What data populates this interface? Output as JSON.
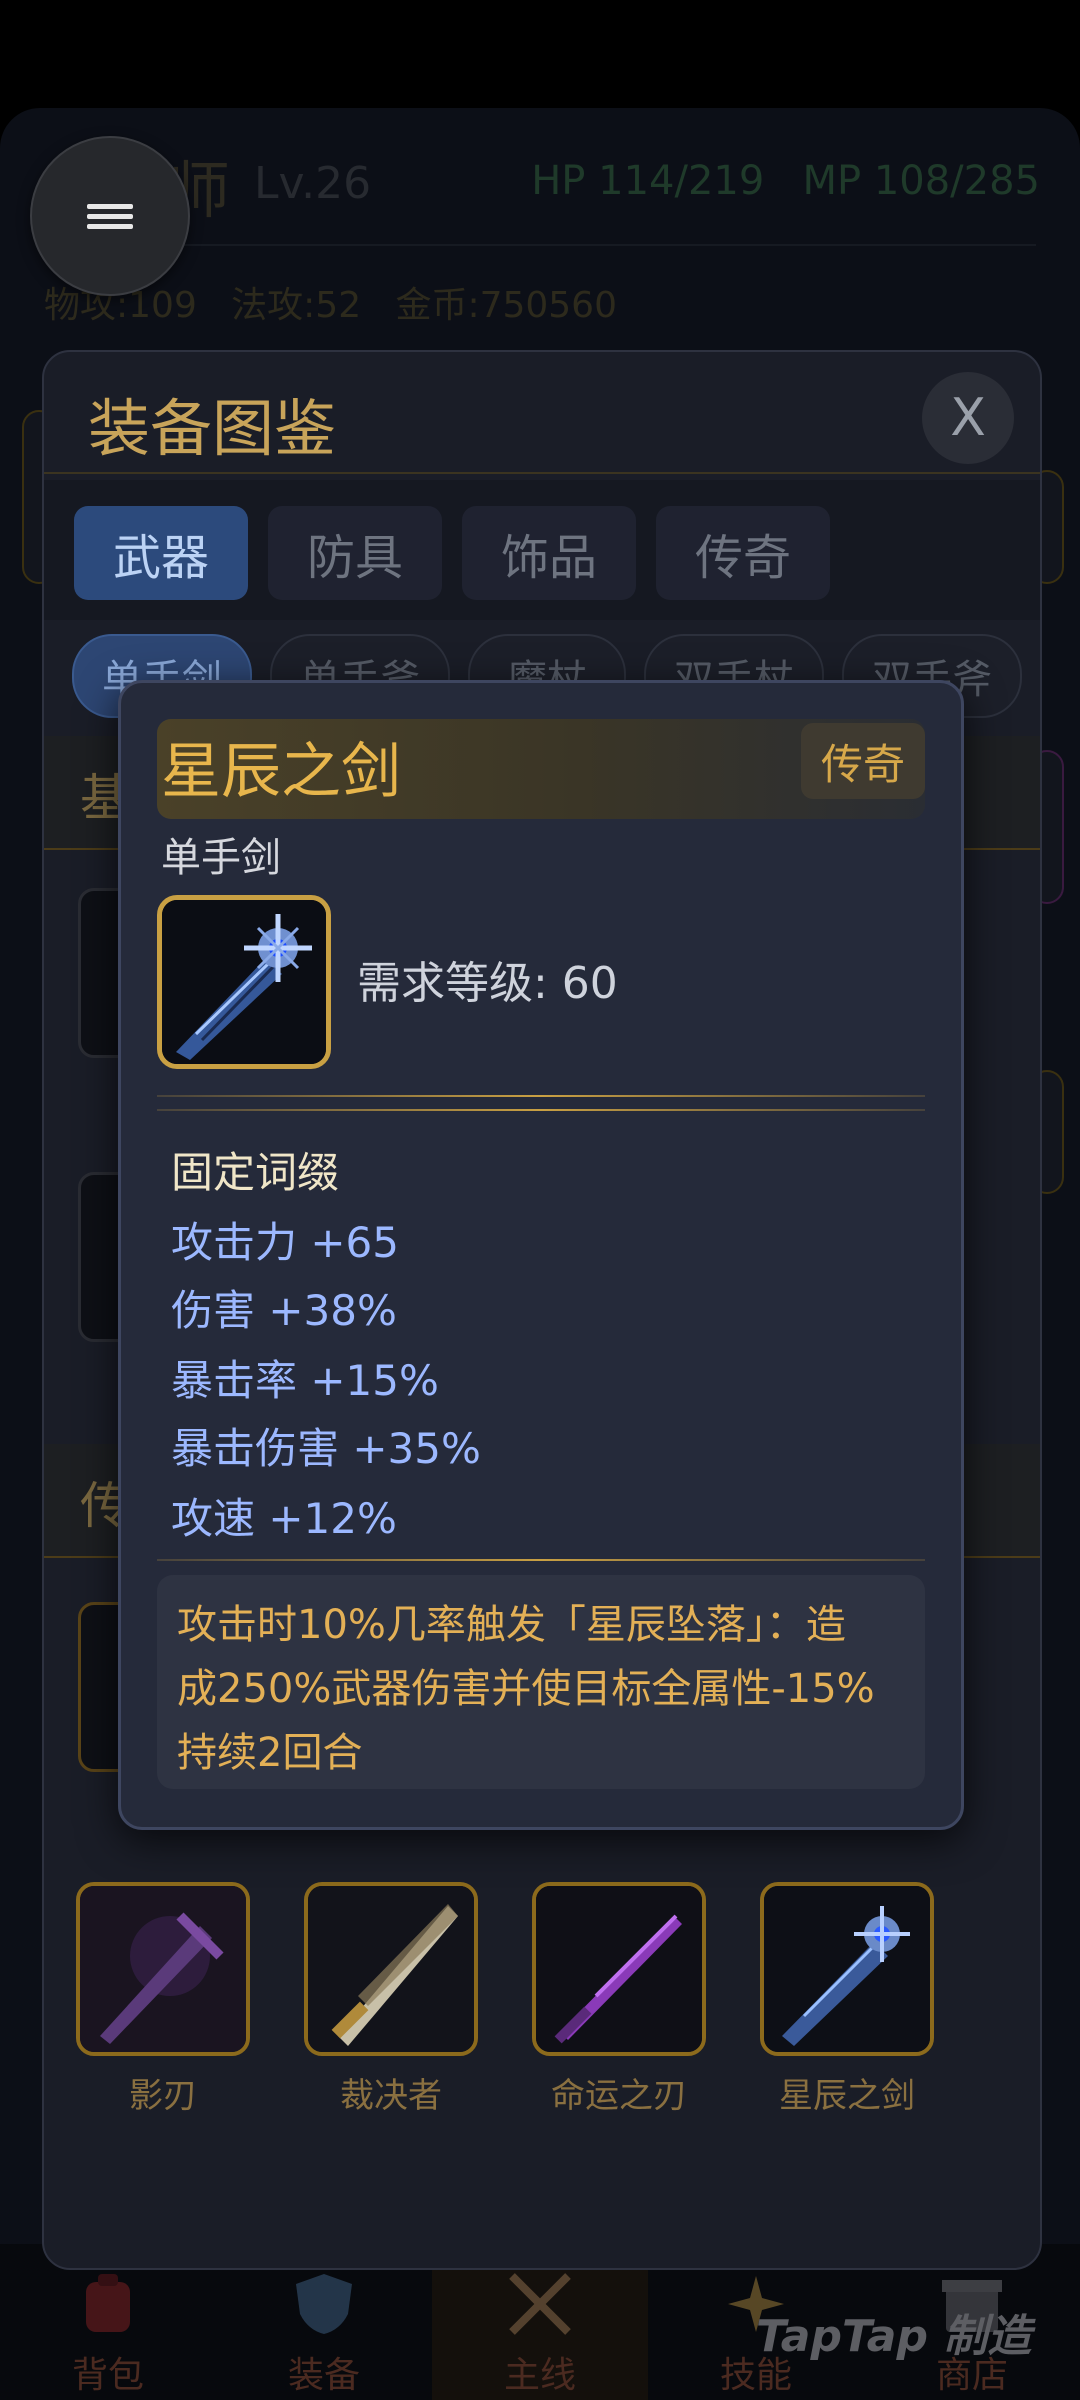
{
  "background": {
    "character": "魔法师",
    "level": "Lv.26",
    "hp": "HP 114/219",
    "mp": "MP 108/285",
    "stats": "物攻:109   法攻:52   金币:750560"
  },
  "panel": {
    "title": "装备图鉴",
    "close_label": "X",
    "tabs": [
      "武器",
      "防具",
      "饰品",
      "传奇"
    ],
    "chips": [
      "单手剑",
      "单手斧",
      "魔杖",
      "双手杖",
      "双手斧"
    ],
    "section_titles": [
      "基",
      "传"
    ],
    "items": [
      {
        "name": "影刃",
        "icon": "shadow-blade-icon"
      },
      {
        "name": "裁决者",
        "icon": "judgement-sword-icon"
      },
      {
        "name": "命运之刃",
        "icon": "fate-blade-icon"
      },
      {
        "name": "星辰之剑",
        "icon": "star-sword-icon"
      }
    ]
  },
  "tooltip": {
    "name": "星辰之剑",
    "rarity": "传奇",
    "type": "单手剑",
    "requirement": "需求等级: 60",
    "fixed_affix_title": "固定词缀",
    "stats": [
      "攻击力 +65",
      "伤害 +38%",
      "暴击率 +15%",
      "暴击伤害 +35%",
      "攻速 +12%"
    ],
    "description": "攻击时10%几率触发「星辰坠落」：造成250%武器伤害并使目标全属性-15%持续2回合"
  },
  "nav": [
    {
      "label": "背包",
      "icon": "backpack-icon"
    },
    {
      "label": "装备",
      "icon": "shield-icon"
    },
    {
      "label": "主线",
      "icon": "crossed-swords-icon"
    },
    {
      "label": "技能",
      "icon": "sparkle-icon"
    },
    {
      "label": "商店",
      "icon": "shop-icon"
    }
  ],
  "watermark": "TapTap 制造",
  "colors": {
    "accent_gold": "#c9a043",
    "tab_active": "#2c4a7c",
    "stat_blue": "#9cb8ff"
  }
}
